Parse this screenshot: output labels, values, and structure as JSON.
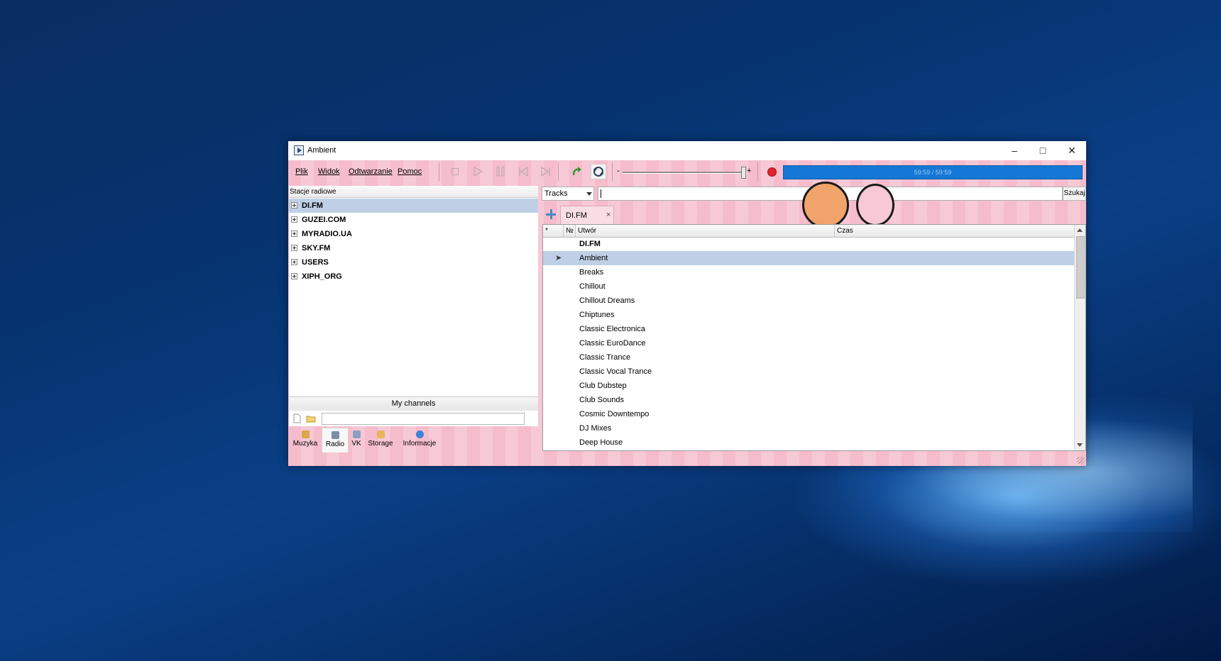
{
  "window": {
    "title": "Ambient",
    "controls": [
      "minimize",
      "maximize",
      "close"
    ]
  },
  "menu": [
    {
      "label": "Plik"
    },
    {
      "label": "Widok"
    },
    {
      "label": "Odtwarzanie"
    },
    {
      "label": "Pomoc"
    }
  ],
  "toolbar": {
    "icons": [
      "stop-icon",
      "play-icon",
      "pause-icon",
      "previous-icon",
      "next-icon",
      "refresh-icon",
      "repeat-icon"
    ],
    "volume": {
      "minus": "-",
      "plus": "+",
      "level": 0.95
    },
    "record_icon": "record-icon",
    "progress": {
      "text": "59:59 / 59:59",
      "fraction": 1.0,
      "color": "#1577d6"
    }
  },
  "left_panel": {
    "header": "Stacje radiowe",
    "items": [
      {
        "label": "DI.FM",
        "selected": true
      },
      {
        "label": "GUZEI.COM"
      },
      {
        "label": "MYRADIO.UA"
      },
      {
        "label": "SKY.FM"
      },
      {
        "label": "USERS"
      },
      {
        "label": "XIPH_ORG"
      }
    ],
    "footer": "My channels"
  },
  "bottom_tabs": [
    {
      "label": "Muzyka",
      "icon": "music-icon"
    },
    {
      "label": "Radio",
      "icon": "radio-icon",
      "active": true
    },
    {
      "label": "VK",
      "icon": "vk-icon"
    },
    {
      "label": "Storage",
      "icon": "storage-icon"
    },
    {
      "label": "Informacje",
      "icon": "info-icon"
    }
  ],
  "search": {
    "scope": "Tracks",
    "value": "",
    "button": "Szukaj"
  },
  "playlist_tab": {
    "label": "DI.FM",
    "close": "×"
  },
  "playlist": {
    "columns": [
      "*",
      "№",
      "Utwór",
      "Czas"
    ],
    "rows": [
      {
        "title": "DI.FM",
        "group": true
      },
      {
        "title": "Ambient",
        "selected": true,
        "playing": true
      },
      {
        "title": "Breaks"
      },
      {
        "title": "Chillout"
      },
      {
        "title": "Chillout Dreams"
      },
      {
        "title": "Chiptunes"
      },
      {
        "title": "Classic Electronica"
      },
      {
        "title": "Classic EuroDance"
      },
      {
        "title": "Classic Trance"
      },
      {
        "title": "Classic Vocal Trance"
      },
      {
        "title": "Club Dubstep"
      },
      {
        "title": "Club Sounds"
      },
      {
        "title": "Cosmic Downtempo"
      },
      {
        "title": "DJ Mixes"
      },
      {
        "title": "Deep House"
      }
    ]
  },
  "colors": {
    "skin_pink": "#f5bccb",
    "selection": "#bfd0e6",
    "accent_blue": "#1577d6",
    "record_red": "#e0262d"
  }
}
